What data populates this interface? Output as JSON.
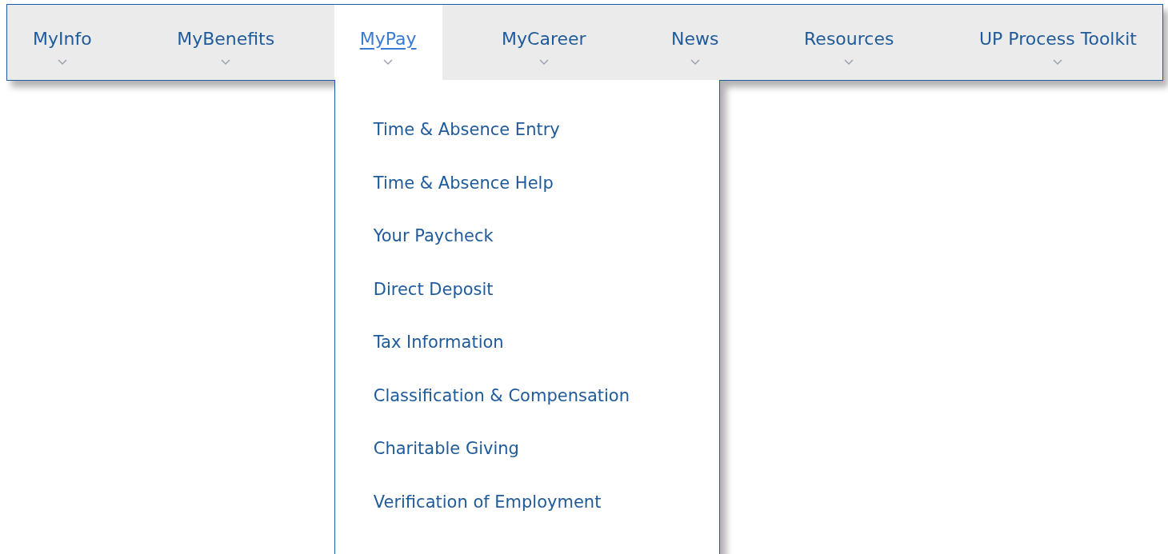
{
  "nav": {
    "tabs": [
      {
        "label": "MyInfo",
        "selected": false
      },
      {
        "label": "MyBenefits",
        "selected": false
      },
      {
        "label": "MyPay",
        "selected": true
      },
      {
        "label": "MyCareer",
        "selected": false
      },
      {
        "label": "News",
        "selected": false
      },
      {
        "label": "Resources",
        "selected": false
      },
      {
        "label": "UP Process Toolkit",
        "selected": false
      }
    ]
  },
  "dropdown": {
    "items": [
      "Time & Absence Entry",
      "Time & Absence Help",
      "Your Paycheck",
      "Direct Deposit",
      "Tax Information",
      "Classification & Compensation",
      "Charitable Giving",
      "Verification of Employment"
    ]
  }
}
